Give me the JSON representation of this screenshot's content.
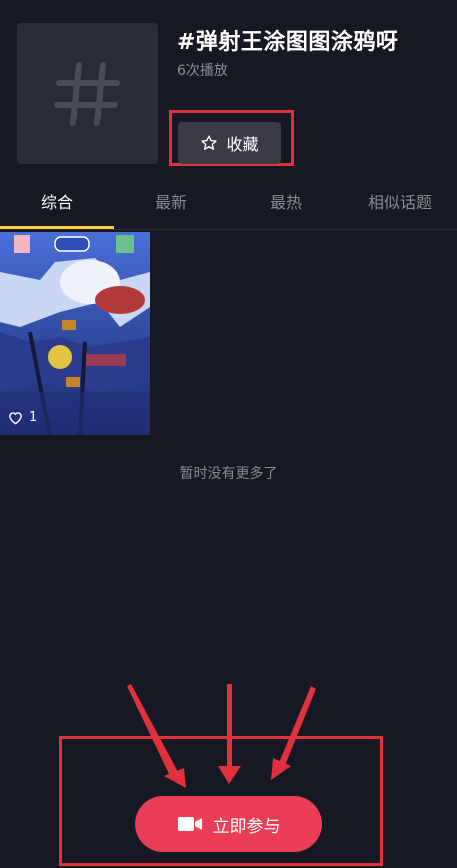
{
  "topic": {
    "cover_icon": "hash-icon",
    "title": "#弹射王涂图图涂鸦呀",
    "plays": "6次播放",
    "collect_label": "收藏"
  },
  "tabs": [
    {
      "label": "综合",
      "active": true
    },
    {
      "label": "最新",
      "active": false
    },
    {
      "label": "最热",
      "active": false
    },
    {
      "label": "相似话题",
      "active": false
    }
  ],
  "videos": [
    {
      "likes": "1"
    }
  ],
  "footer_text": "暂时没有更多了",
  "join_button": {
    "label": "立即参与",
    "icon": "video-camera-icon"
  },
  "colors": {
    "background": "#161823",
    "accent": "#ea3d57",
    "tab_indicator": "#fbcf3a",
    "annotation": "#e0323c"
  }
}
